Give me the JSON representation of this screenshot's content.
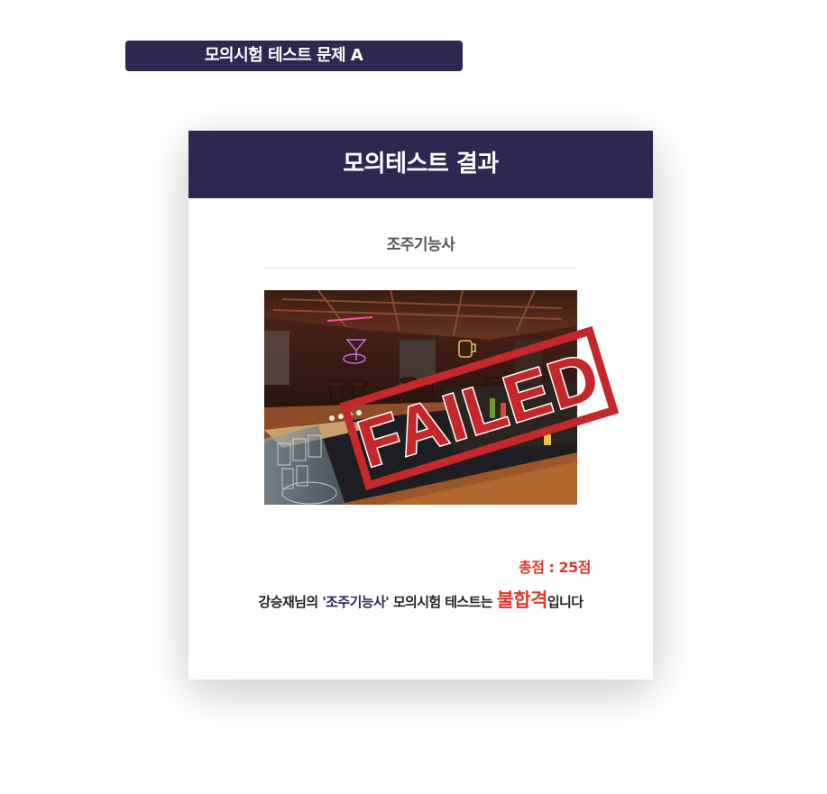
{
  "page": {
    "test_title": "모의시험 테스트 문제 A"
  },
  "result_card": {
    "header": "모의테스트 결과",
    "subject": "조주기능사",
    "stamp_text": "FAILED",
    "score_label": "총점",
    "score_separator": " : ",
    "score_value": "25점",
    "message": {
      "user": "강승재님의",
      "subject_quoted": "'조주기능사'",
      "middle": "모의시험 테스트는",
      "result": "불합격",
      "suffix": "입니다"
    }
  },
  "colors": {
    "header_bg": "#2d2752",
    "accent_fail": "#e0392c",
    "stamp_red": "#c4282a"
  }
}
